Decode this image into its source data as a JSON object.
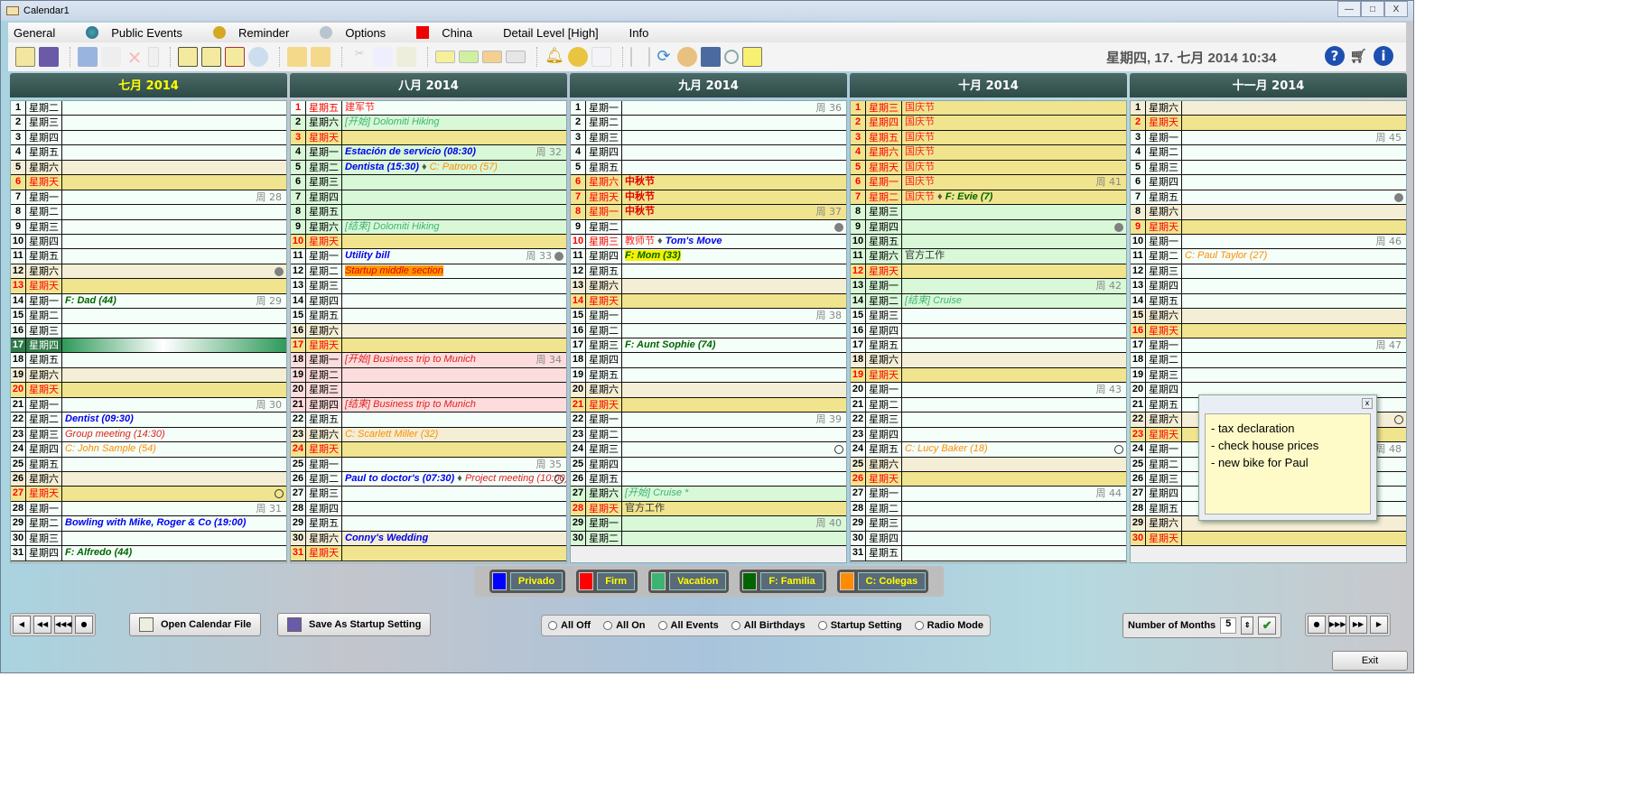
{
  "window": {
    "title": "Calendar1",
    "controls": [
      "—",
      "□",
      "X"
    ]
  },
  "menu": [
    {
      "label": "General",
      "icon": ""
    },
    {
      "label": "Public Events",
      "icon": "globe-icon"
    },
    {
      "label": "Reminder",
      "icon": "bell-icon"
    },
    {
      "label": "Options",
      "icon": "gear-icon"
    },
    {
      "label": "China",
      "icon": "china-flag-icon"
    },
    {
      "label": "Detail Level [High]",
      "icon": ""
    },
    {
      "label": "Info",
      "icon": ""
    }
  ],
  "toolbar": {
    "clock": "星期四, 17. 七月 2014  10:34"
  },
  "weekdays": [
    "星期一",
    "星期二",
    "星期三",
    "星期四",
    "星期五",
    "星期六",
    "星期天"
  ],
  "colors": {
    "header": "#2d4a47",
    "today": "#2f7a4a",
    "saturday": "#f3eed5",
    "sunday": "#f0e48e",
    "vacation": "#d8f8d8",
    "trip": "#fcdcdc"
  },
  "months": [
    {
      "title": "七月 2014",
      "title_color": "#ffff00",
      "first_weekday": 1,
      "days": 31,
      "today": 17,
      "days_info": {
        "7": {
          "week": "周 28"
        },
        "12": {
          "marker": "filled"
        },
        "14": {
          "week": "周 29",
          "events": [
            {
              "t": "F: Dad (44)",
              "s": "fam"
            }
          ]
        },
        "21": {
          "week": "周 30"
        },
        "22": {
          "events": [
            {
              "t": "Dentist (09:30)",
              "s": "appt"
            }
          ]
        },
        "23": {
          "events": [
            {
              "t": "Group meeting (14:30)",
              "s": "meet"
            }
          ]
        },
        "24": {
          "events": [
            {
              "t": "C: John Sample (54)",
              "s": "col"
            }
          ]
        },
        "27": {
          "marker": "hollow"
        },
        "28": {
          "week": "周 31"
        },
        "29": {
          "events": [
            {
              "t": "Bowling with Mike, Roger & Co (19:00)",
              "s": "appt"
            }
          ]
        },
        "31": {
          "events": [
            {
              "t": "F: Alfredo (44)",
              "s": "fam"
            }
          ]
        }
      }
    },
    {
      "title": "八月 2014",
      "first_weekday": 4,
      "days": 31,
      "days_info": {
        "1": {
          "holiday": true,
          "bg": "",
          "events": [
            {
              "t": "建军节",
              "s": "hol"
            }
          ]
        },
        "2": {
          "bg": "vac",
          "events": [
            {
              "t": "[开始] Dolomiti Hiking",
              "s": "vac"
            }
          ]
        },
        "4": {
          "bg": "vac",
          "week": "周 32",
          "events": [
            {
              "t": "Estación de servicio (08:30)",
              "s": "appt"
            }
          ]
        },
        "5": {
          "bg": "vac",
          "events": [
            {
              "t": "Dentista (15:30)",
              "s": "appt"
            },
            {
              "t": "C: Patrono (57)",
              "s": "col"
            }
          ]
        },
        "6": {
          "bg": "vac"
        },
        "7": {
          "bg": "vac"
        },
        "8": {
          "bg": "vac"
        },
        "9": {
          "bg": "vac",
          "events": [
            {
              "t": "[结束] Dolomiti Hiking",
              "s": "vac"
            }
          ]
        },
        "11": {
          "week": "周 33",
          "marker": "filled",
          "events": [
            {
              "t": "Utility bill",
              "s": "appt"
            }
          ]
        },
        "12": {
          "events": [
            {
              "t": "Startup middle section",
              "s": "hl"
            }
          ]
        },
        "18": {
          "bg": "trip",
          "week": "周 34",
          "events": [
            {
              "t": "[开始] Business trip to Munich",
              "s": "trip"
            }
          ]
        },
        "19": {
          "bg": "trip"
        },
        "20": {
          "bg": "trip"
        },
        "21": {
          "bg": "trip",
          "events": [
            {
              "t": "[结束] Business trip to Munich",
              "s": "trip"
            }
          ]
        },
        "23": {
          "events": [
            {
              "t": "C: Scarlett Miller (32)",
              "s": "col"
            }
          ]
        },
        "25": {
          "week": "周 35"
        },
        "26": {
          "marker": "hollow",
          "events": [
            {
              "t": "Paul to doctor's (07:30)",
              "s": "appt"
            },
            {
              "t": "Project meeting (10:00)",
              "s": "meet"
            }
          ]
        },
        "30": {
          "events": [
            {
              "t": "Conny's Wedding",
              "s": "appt"
            }
          ]
        }
      }
    },
    {
      "title": "九月 2014",
      "first_weekday": 0,
      "days": 30,
      "days_info": {
        "1": {
          "week": "周 36"
        },
        "6": {
          "holiday": true,
          "bg": "sun",
          "events": [
            {
              "t": "中秋节",
              "s": "holb"
            }
          ]
        },
        "7": {
          "holiday": true,
          "events": [
            {
              "t": "中秋节",
              "s": "holb"
            }
          ]
        },
        "8": {
          "holiday": true,
          "bg": "sun",
          "week": "周 37",
          "events": [
            {
              "t": "中秋节",
              "s": "holb"
            }
          ]
        },
        "9": {
          "marker": "filled"
        },
        "10": {
          "holiday": true,
          "events": [
            {
              "t": "教师节",
              "s": "hol"
            },
            {
              "t": "Tom's Move",
              "s": "appt"
            }
          ]
        },
        "11": {
          "events": [
            {
              "t": "F: Mom (33)",
              "s": "hly"
            }
          ]
        },
        "15": {
          "week": "周 38"
        },
        "17": {
          "events": [
            {
              "t": "F: Aunt Sophie (74)",
              "s": "fam"
            }
          ]
        },
        "22": {
          "week": "周 39"
        },
        "24": {
          "marker": "hollow"
        },
        "27": {
          "bg": "vac",
          "events": [
            {
              "t": "[开始] Cruise *",
              "s": "vac"
            }
          ]
        },
        "28": {
          "events": [
            {
              "t": "官方工作",
              "s": "plain"
            }
          ]
        },
        "29": {
          "bg": "vac",
          "week": "周 40"
        },
        "30": {
          "bg": "vac"
        }
      }
    },
    {
      "title": "十月 2014",
      "first_weekday": 2,
      "days": 31,
      "days_info": {
        "1": {
          "holiday": true,
          "bg": "sun",
          "events": [
            {
              "t": "国庆节",
              "s": "hol"
            }
          ]
        },
        "2": {
          "holiday": true,
          "bg": "sun",
          "events": [
            {
              "t": "国庆节",
              "s": "hol"
            }
          ]
        },
        "3": {
          "holiday": true,
          "bg": "sun",
          "events": [
            {
              "t": "国庆节",
              "s": "hol"
            }
          ]
        },
        "4": {
          "holiday": true,
          "bg": "sun",
          "events": [
            {
              "t": "国庆节",
              "s": "hol"
            }
          ]
        },
        "5": {
          "holiday": true,
          "bg": "sun",
          "events": [
            {
              "t": "国庆节",
              "s": "hol"
            }
          ]
        },
        "6": {
          "holiday": true,
          "bg": "sun",
          "week": "周 41",
          "events": [
            {
              "t": "国庆节",
              "s": "hol"
            }
          ]
        },
        "7": {
          "holiday": true,
          "bg": "sun",
          "events": [
            {
              "t": "国庆节",
              "s": "hol"
            },
            {
              "t": "F: Evie (7)",
              "s": "fam"
            }
          ]
        },
        "8": {
          "bg": "vac"
        },
        "9": {
          "bg": "vac",
          "marker": "filled"
        },
        "10": {
          "bg": "vac"
        },
        "11": {
          "bg": "vac",
          "events": [
            {
              "t": "官方工作",
              "s": "plain"
            }
          ]
        },
        "13": {
          "bg": "vac",
          "week": "周 42"
        },
        "14": {
          "bg": "vac",
          "events": [
            {
              "t": "[结束] Cruise",
              "s": "vac"
            }
          ]
        },
        "20": {
          "week": "周 43"
        },
        "24": {
          "marker": "hollow",
          "events": [
            {
              "t": "C: Lucy Baker (18)",
              "s": "col"
            }
          ]
        },
        "27": {
          "week": "周 44"
        }
      }
    },
    {
      "title": "十一月 2014",
      "first_weekday": 5,
      "days": 30,
      "days_info": {
        "3": {
          "week": "周 45"
        },
        "7": {
          "marker": "filled"
        },
        "10": {
          "week": "周 46"
        },
        "11": {
          "events": [
            {
              "t": "C: Paul Taylor (27)",
              "s": "col"
            }
          ]
        },
        "17": {
          "week": "周 47"
        },
        "22": {
          "marker": "hollow"
        },
        "24": {
          "week": "周 48"
        }
      }
    }
  ],
  "note": {
    "lines": [
      "- tax declaration",
      "- check house prices",
      "- new bike for Paul"
    ],
    "close": "x"
  },
  "legend": [
    {
      "label": "Privado",
      "color": "#0000ff"
    },
    {
      "label": "Firm",
      "color": "#ff0000"
    },
    {
      "label": "Vacation",
      "color": "#3cb371"
    },
    {
      "label": "F: Familia",
      "color": "#006400"
    },
    {
      "label": "C: Colegas",
      "color": "#ff8c00"
    }
  ],
  "bottom": {
    "open_file": "Open Calendar File",
    "save_startup": "Save As Startup Setting",
    "radios": [
      "All Off",
      "All On",
      "All Events",
      "All Birthdays",
      "Startup Setting",
      "Radio Mode"
    ],
    "months_label": "Number of Months",
    "months_value": "5",
    "exit": "Exit",
    "nav_left": [
      "◀",
      "◀◀",
      "◀◀◀",
      "●"
    ],
    "nav_right": [
      "●",
      "▶▶▶",
      "▶▶",
      "▶"
    ]
  }
}
